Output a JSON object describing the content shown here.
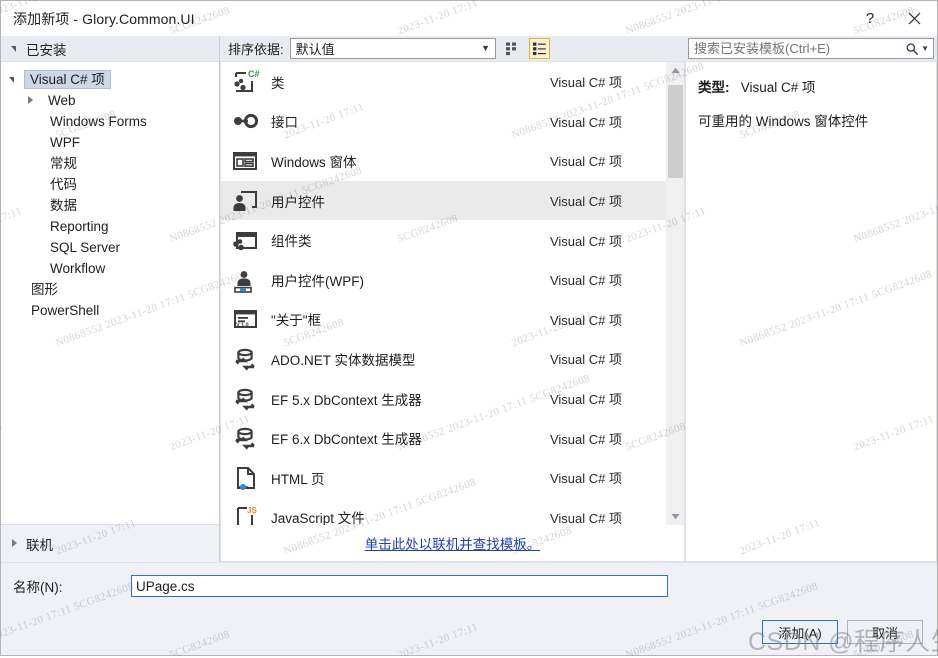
{
  "window": {
    "title": "添加新项 - Glory.Common.UI",
    "help_button": "?",
    "close_button": "✕"
  },
  "sidebar": {
    "header": "已安装",
    "tree": [
      {
        "label": "Visual C# 项",
        "level": 0,
        "expander": "down",
        "selected": true
      },
      {
        "label": "Web",
        "level": 1,
        "expander": "right",
        "selected": false
      },
      {
        "label": "Windows Forms",
        "level": 2,
        "expander": "none",
        "selected": false
      },
      {
        "label": "WPF",
        "level": 2,
        "expander": "none",
        "selected": false
      },
      {
        "label": "常规",
        "level": 2,
        "expander": "none",
        "selected": false
      },
      {
        "label": "代码",
        "level": 2,
        "expander": "none",
        "selected": false
      },
      {
        "label": "数据",
        "level": 2,
        "expander": "none",
        "selected": false
      },
      {
        "label": "Reporting",
        "level": 2,
        "expander": "none",
        "selected": false
      },
      {
        "label": "SQL Server",
        "level": 2,
        "expander": "none",
        "selected": false
      },
      {
        "label": "Workflow",
        "level": 2,
        "expander": "none",
        "selected": false
      },
      {
        "label": "图形",
        "level": 1,
        "expander": "none",
        "selected": false
      },
      {
        "label": "PowerShell",
        "level": 1,
        "expander": "none",
        "selected": false
      }
    ],
    "online_section": "联机"
  },
  "toolbar": {
    "sort_label": "排序依据:",
    "sort_value": "默认值",
    "sort_options": [
      "默认值"
    ],
    "view_tiles_icon": "grid-view-icon",
    "view_list_icon": "list-view-icon",
    "active_view": "list"
  },
  "templates": {
    "kind_all": "Visual C# 项",
    "items": [
      {
        "name": "类",
        "kind": "Visual C# 项",
        "icon": "class-icon",
        "selected": false
      },
      {
        "name": "接口",
        "kind": "Visual C# 项",
        "icon": "interface-icon",
        "selected": false
      },
      {
        "name": "Windows 窗体",
        "kind": "Visual C# 项",
        "icon": "windows-form-icon",
        "selected": false
      },
      {
        "name": "用户控件",
        "kind": "Visual C# 项",
        "icon": "user-control-icon",
        "selected": true
      },
      {
        "name": "组件类",
        "kind": "Visual C# 项",
        "icon": "component-class-icon",
        "selected": false
      },
      {
        "name": "用户控件(WPF)",
        "kind": "Visual C# 项",
        "icon": "wpf-user-control-icon",
        "selected": false
      },
      {
        "name": "\"关于\"框",
        "kind": "Visual C# 项",
        "icon": "about-box-icon",
        "selected": false
      },
      {
        "name": "ADO.NET 实体数据模型",
        "kind": "Visual C# 项",
        "icon": "ado-entity-model-icon",
        "selected": false
      },
      {
        "name": "EF 5.x DbContext 生成器",
        "kind": "Visual C# 项",
        "icon": "ef-dbcontext-icon",
        "selected": false
      },
      {
        "name": "EF 6.x DbContext 生成器",
        "kind": "Visual C# 项",
        "icon": "ef-dbcontext-icon",
        "selected": false
      },
      {
        "name": "HTML 页",
        "kind": "Visual C# 项",
        "icon": "html-page-icon",
        "selected": false
      },
      {
        "name": "JavaScript 文件",
        "kind": "Visual C# 项",
        "icon": "javascript-file-icon",
        "selected": false
      }
    ],
    "find_online_link": "单击此处以联机并查找模板。"
  },
  "search": {
    "placeholder": "搜索已安装模板(Ctrl+E)",
    "value": "",
    "icon": "search-icon"
  },
  "details": {
    "type_key": "类型:",
    "type_value": "Visual C# 项",
    "description": "可重用的 Windows 窗体控件"
  },
  "footer": {
    "name_label": "名称(N):",
    "name_value": "UPage.cs",
    "add_button": "添加(A)",
    "cancel_button": "取消"
  },
  "watermarks": {
    "csdn": "CSDN @程序人生wp",
    "tiles": [
      "N0868552 2023-11-20 17:11 5CG8242608",
      "5CG8242608",
      "2023-11-20 17:11"
    ]
  },
  "colors": {
    "accent_blue": "#2a6fd6",
    "link_blue": "#1f3fbf",
    "selection_gray": "#eaeaea",
    "tree_selection": "#cfd6e6",
    "panel_bg": "#eff1f7",
    "toolbar_active": "#e3b22b"
  }
}
